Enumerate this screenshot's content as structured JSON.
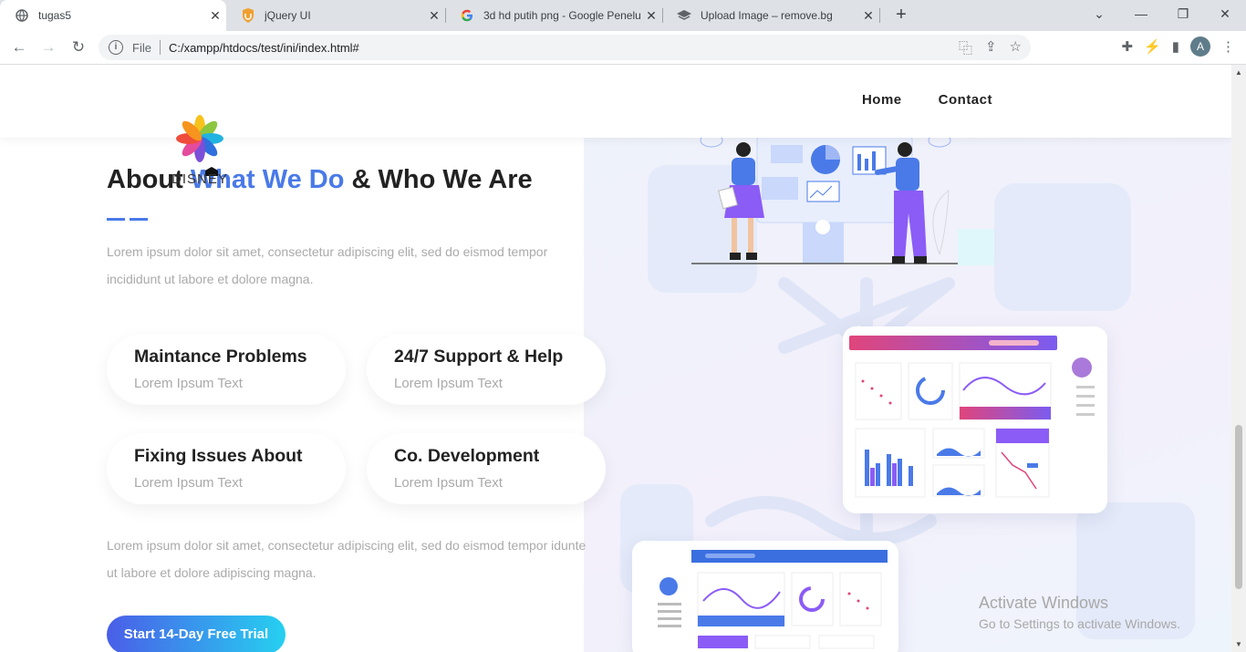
{
  "browser": {
    "tabs": [
      {
        "title": "tugas5",
        "icon": "globe-icon",
        "active": true
      },
      {
        "title": "jQuery UI",
        "icon": "shield-icon",
        "active": false
      },
      {
        "title": "3d hd putih png - Google Penelu",
        "icon": "google-icon",
        "active": false
      },
      {
        "title": "Upload Image – remove.bg",
        "icon": "removebg-icon",
        "active": false
      }
    ],
    "address": {
      "scheme_label": "File",
      "url": "C:/xampp/htdocs/test/ini/index.html#"
    },
    "profile_initial": "A"
  },
  "site": {
    "nav": {
      "home": "Home",
      "contact": "Contact"
    },
    "logo_text": "DISNEY",
    "about": {
      "title_part1": "About ",
      "title_highlight": "What We Do",
      "title_part2": " & Who We Are",
      "intro": "Lorem ipsum dolor sit amet, consectetur adipiscing elit, sed do eismod tempor incididunt ut labore et dolore magna.",
      "outro": "Lorem ipsum dolor sit amet, consectetur adipiscing elit, sed do eismod tempor idunte ut labore et dolore adipiscing magna."
    },
    "features": [
      {
        "title": "Maintance Problems",
        "subtitle": "Lorem Ipsum Text"
      },
      {
        "title": "24/7 Support & Help",
        "subtitle": "Lorem Ipsum Text"
      },
      {
        "title": "Fixing Issues About",
        "subtitle": "Lorem Ipsum Text"
      },
      {
        "title": "Co. Development",
        "subtitle": "Lorem Ipsum Text"
      }
    ],
    "cta_label": "Start 14-Day Free Trial"
  },
  "os_watermark": {
    "line1": "Activate Windows",
    "line2": "Go to Settings to activate Windows."
  },
  "colors": {
    "accent": "#4a7ae8",
    "heading": "#222222",
    "muted_text": "#aaaaaa",
    "cta_start": "#4a5ee8",
    "cta_end": "#26d0f0"
  }
}
